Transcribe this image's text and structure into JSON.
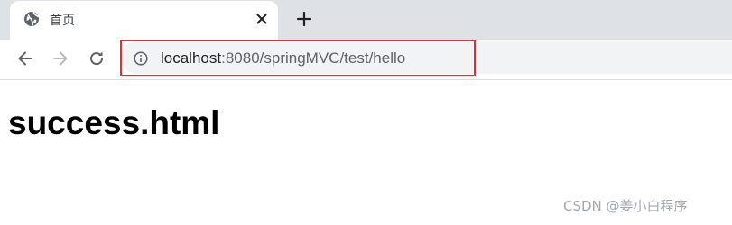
{
  "tab": {
    "title": "首页",
    "favicon": "globe-icon"
  },
  "toolbar": {
    "back_icon": "back-arrow-icon",
    "forward_icon": "forward-arrow-icon",
    "reload_icon": "reload-icon"
  },
  "address_bar": {
    "host": "localhost",
    "rest": ":8080/springMVC/test/hello",
    "info_icon": "info-icon",
    "highlight_color": "#d9333a"
  },
  "page": {
    "heading": "success.html"
  },
  "watermark": "CSDN @姜小白程序"
}
